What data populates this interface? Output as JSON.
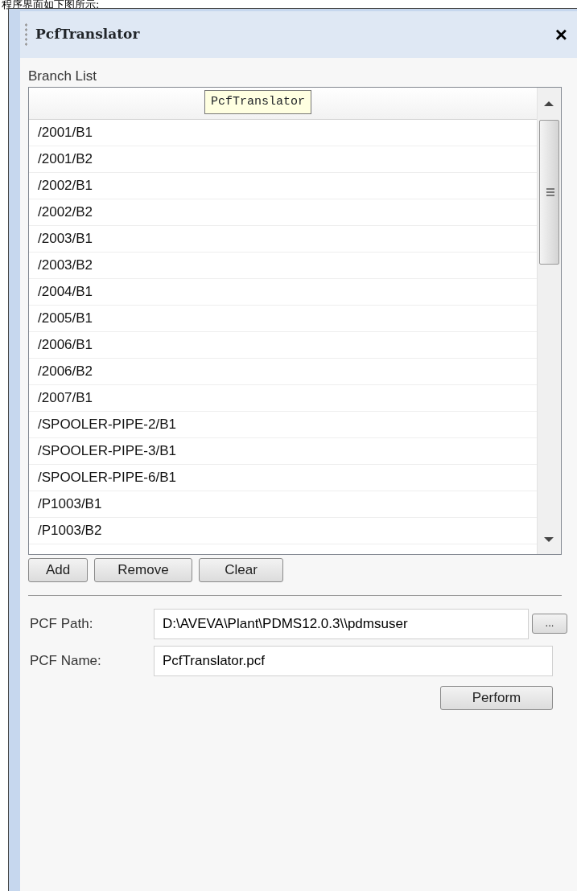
{
  "caption": "程序界面如下图所示:",
  "window": {
    "title": "PcfTranslator",
    "close": "×"
  },
  "branch_list": {
    "label": "Branch List",
    "tooltip": "PcfTranslator",
    "items": [
      "/2001/B1",
      "/2001/B2",
      "/2002/B1",
      "/2002/B2",
      "/2003/B1",
      "/2003/B2",
      "/2004/B1",
      "/2005/B1",
      "/2006/B1",
      "/2006/B2",
      "/2007/B1",
      "/SPOOLER-PIPE-2/B1",
      "/SPOOLER-PIPE-3/B1",
      "/SPOOLER-PIPE-6/B1",
      "/P1003/B1",
      "/P1003/B2"
    ]
  },
  "list_buttons": [
    "Add",
    "Remove",
    "Clear"
  ],
  "fields": [
    {
      "label": "PCF Path:",
      "value": "D:\\AVEVA\\Plant\\PDMS12.0.3\\\\pdmsuser",
      "browse": "..."
    },
    {
      "label": "PCF Name:",
      "value": "PcfTranslator.pcf"
    }
  ],
  "perform_button": "Perform"
}
